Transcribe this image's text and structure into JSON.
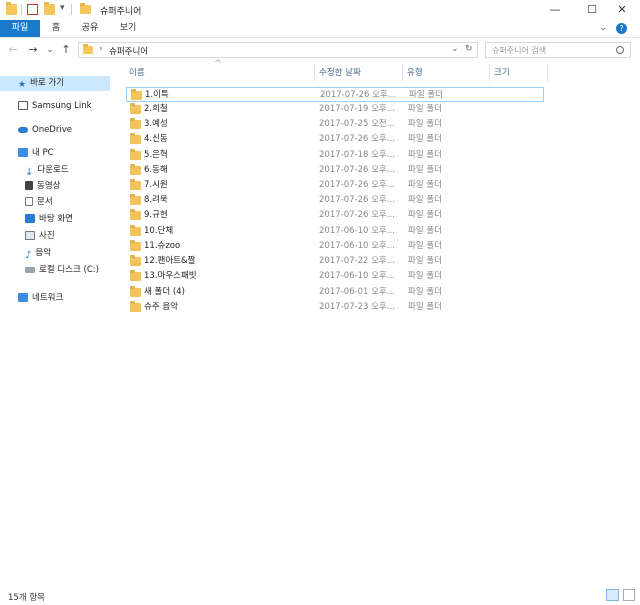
{
  "window": {
    "title": "슈퍼주니어"
  },
  "titlebar": {
    "dropdown_glyph": "▾",
    "minimize": "—",
    "maximize": "☐",
    "close": "✕"
  },
  "ribbon": {
    "tabs": [
      "파일",
      "홈",
      "공유",
      "보기"
    ],
    "expand_glyph": "⌄",
    "help_glyph": "?"
  },
  "nav": {
    "back": "←",
    "forward": "→",
    "recent": "⌄",
    "up": "↑"
  },
  "address": {
    "separator": "›",
    "current": "슈퍼주니어",
    "dropdown": "⌄",
    "refresh": "↻"
  },
  "search": {
    "placeholder": "슈퍼주니어 검색",
    "icon": "search-icon"
  },
  "sidebar": {
    "quick_access": "바로 가기",
    "samsung_link": "Samsung Link",
    "onedrive": "OneDrive",
    "this_pc": "내 PC",
    "pc_items": [
      "다운로드",
      "동영상",
      "문서",
      "바탕 화면",
      "사진",
      "음악",
      "로컬 디스크 (C:)"
    ],
    "network": "네트워크"
  },
  "columns": {
    "name": "이름",
    "date": "수정한 날짜",
    "type": "유형",
    "size": "크기",
    "sort_glyph": "^"
  },
  "files": [
    {
      "name": "1.이특",
      "date": "2017-07-26 오후...",
      "type": "파일 폴더"
    },
    {
      "name": "2.희철",
      "date": "2017-07-19 오후...",
      "type": "파일 폴더"
    },
    {
      "name": "3.예성",
      "date": "2017-07-25 오전...",
      "type": "파일 폴더"
    },
    {
      "name": "4.신동",
      "date": "2017-07-26 오후...",
      "type": "파일 폴더"
    },
    {
      "name": "5.은혁",
      "date": "2017-07-18 오후...",
      "type": "파일 폴더"
    },
    {
      "name": "6.동해",
      "date": "2017-07-26 오후...",
      "type": "파일 폴더"
    },
    {
      "name": "7.시원",
      "date": "2017-07-26 오후...",
      "type": "파일 폴더"
    },
    {
      "name": "8.려욱",
      "date": "2017-07-26 오후...",
      "type": "파일 폴더"
    },
    {
      "name": "9.규현",
      "date": "2017-07-26 오후...",
      "type": "파일 폴더"
    },
    {
      "name": "10.단체",
      "date": "2017-06-10 오후...",
      "type": "파일 폴더"
    },
    {
      "name": "11.슈zoo",
      "date": "2017-06-10 오후...",
      "type": "파일 폴더"
    },
    {
      "name": "12.팬아트&짤",
      "date": "2017-07-22 오후...",
      "type": "파일 폴더"
    },
    {
      "name": "13.마우스패빗",
      "date": "2017-06-10 오후...",
      "type": "파일 폴더"
    },
    {
      "name": "새 폴더 (4)",
      "date": "2017-06-01 오후...",
      "type": "파일 폴더"
    },
    {
      "name": "슈주 음악",
      "date": "2017-07-23 오후...",
      "type": "파일 폴더"
    }
  ],
  "status": {
    "count": "15개 항목"
  },
  "colors": {
    "accent": "#1979ca",
    "folder": "#f2c35a",
    "selection_border": "#99d1ff"
  }
}
